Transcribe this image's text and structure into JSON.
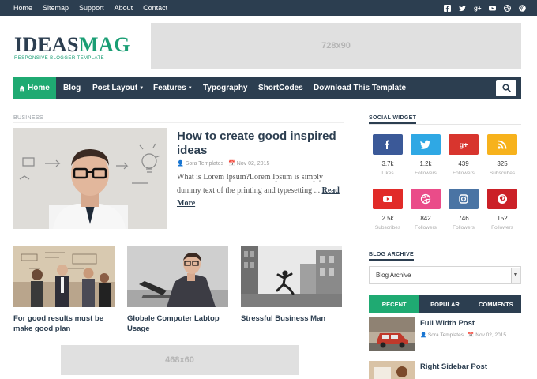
{
  "topbar": {
    "links": [
      "Home",
      "Sitemap",
      "Support",
      "About",
      "Contact"
    ],
    "social_icons": [
      "facebook-icon",
      "twitter-icon",
      "google-plus-icon",
      "youtube-icon",
      "dribbble-icon",
      "pinterest-icon"
    ]
  },
  "header": {
    "logo_part1": "IDEAS",
    "logo_part2": "MAG",
    "tagline": "RESPONSIVE BLOGGER TEMPLATE",
    "ad_label": "728x90"
  },
  "nav": {
    "home": "Home",
    "blog": "Blog",
    "post_layout": "Post Layout",
    "features": "Features",
    "typography": "Typography",
    "shortcodes": "ShortCodes",
    "download": "Download This Template"
  },
  "main": {
    "section_label": "BUSINESS",
    "featured": {
      "title": "How to create good inspired ideas",
      "author": "Sora Templates",
      "date": "Nov 02, 2015",
      "excerpt": "What is Lorem Ipsum?Lorem Ipsum is simply dummy text of the printing and typesetting ...",
      "read_more": "Read More"
    },
    "posts": [
      {
        "title": "For good results must be make good plan"
      },
      {
        "title": "Globale Computer Labtop Usage"
      },
      {
        "title": "Stressful Business Man"
      }
    ],
    "ad_label": "468x60"
  },
  "sidebar": {
    "social_title": "SOCIAL WIDGET",
    "social": [
      {
        "count": "3.7k",
        "label": "Likes",
        "icon": "facebook-icon",
        "color": "#3b5998"
      },
      {
        "count": "1.2k",
        "label": "Followers",
        "icon": "twitter-icon",
        "color": "#2fa8e4"
      },
      {
        "count": "439",
        "label": "Followers",
        "icon": "google-plus-icon",
        "color": "#d8352e"
      },
      {
        "count": "325",
        "label": "Subscribes",
        "icon": "rss-icon",
        "color": "#f7b21c"
      },
      {
        "count": "2.5k",
        "label": "Subscribes",
        "icon": "youtube-icon",
        "color": "#e12b28"
      },
      {
        "count": "842",
        "label": "Followers",
        "icon": "dribbble-icon",
        "color": "#ea4c89"
      },
      {
        "count": "746",
        "label": "Followers",
        "icon": "instagram-icon",
        "color": "#4a74a4"
      },
      {
        "count": "152",
        "label": "Followers",
        "icon": "pinterest-icon",
        "color": "#cb2027"
      }
    ],
    "archive_title": "BLOG ARCHIVE",
    "archive_select": "Blog Archive",
    "tabs": [
      "RECENT",
      "POPULAR",
      "COMMENTS"
    ],
    "recent_posts": [
      {
        "title": "Full Width Post",
        "author": "Sora Templates",
        "date": "Nov 02, 2015"
      },
      {
        "title": "Right Sidebar Post"
      }
    ]
  },
  "colors": {
    "dark": "#2c3e50",
    "accent": "#1faa72",
    "ad_bg": "#e0e0e0"
  }
}
